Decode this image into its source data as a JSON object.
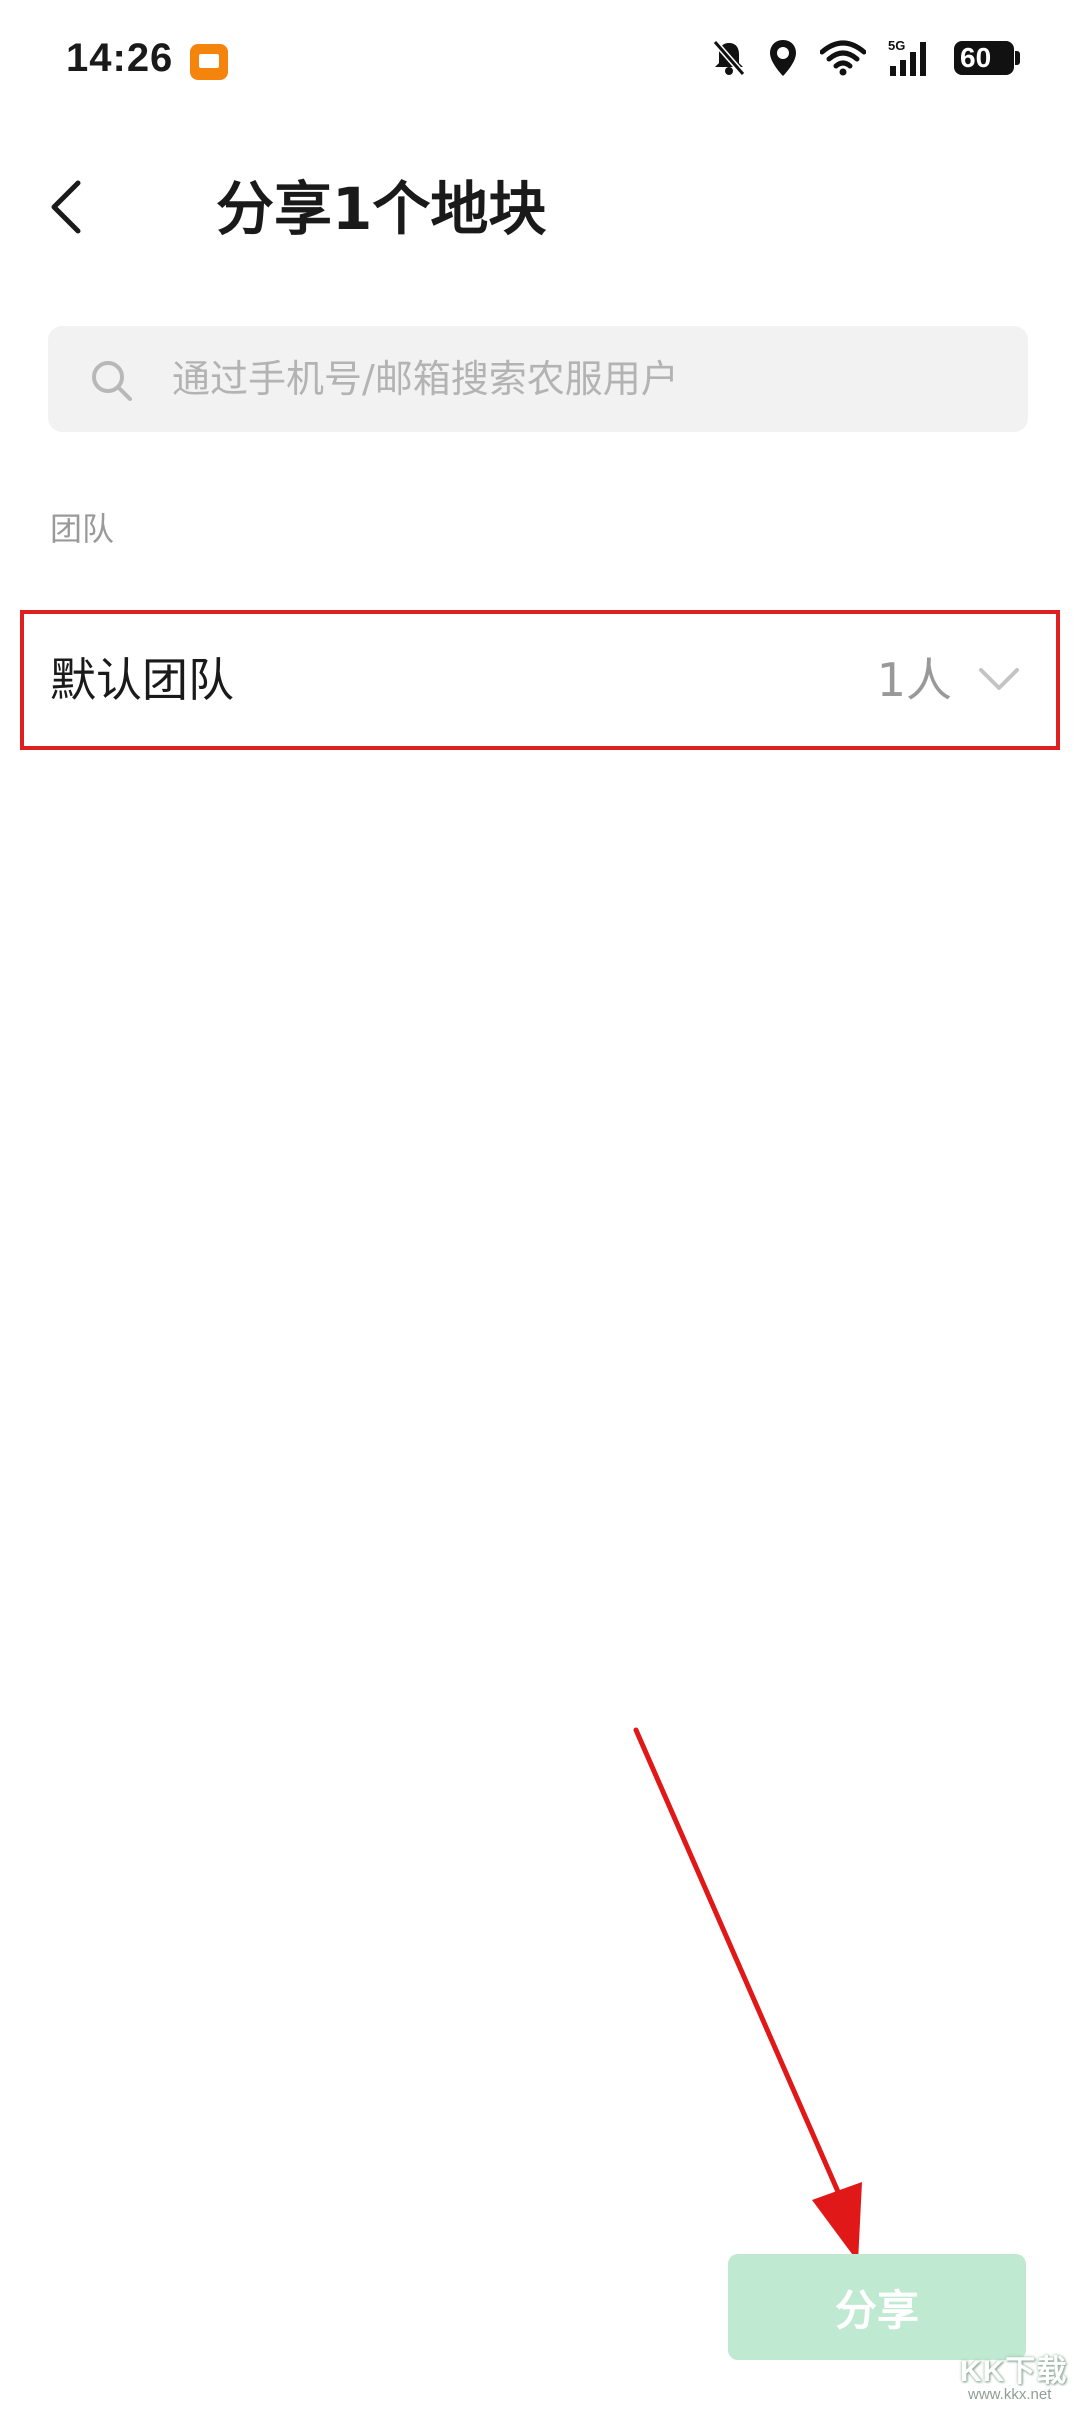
{
  "status_bar": {
    "time": "14:26",
    "network_label": "5G",
    "battery": "60",
    "icons": [
      "app-notification-icon",
      "bell-off-icon",
      "location-pin-icon",
      "wifi-icon",
      "signal-icon",
      "battery-icon"
    ]
  },
  "header": {
    "back_icon": "chevron-left-icon",
    "title": "分享1个地块"
  },
  "search": {
    "icon": "search-icon",
    "placeholder": "通过手机号/邮箱搜索农服用户"
  },
  "section": {
    "label": "团队"
  },
  "team_list": [
    {
      "name": "默认团队",
      "count": "1人",
      "icon": "chevron-down-icon"
    }
  ],
  "footer": {
    "share_label": "分享"
  },
  "watermark": {
    "text": "KK下载",
    "url": "www.kkx.net"
  },
  "colors": {
    "accent_disabled": "#bfe9d1",
    "highlight_border": "#e02020",
    "annotation_arrow": "#e01818"
  }
}
